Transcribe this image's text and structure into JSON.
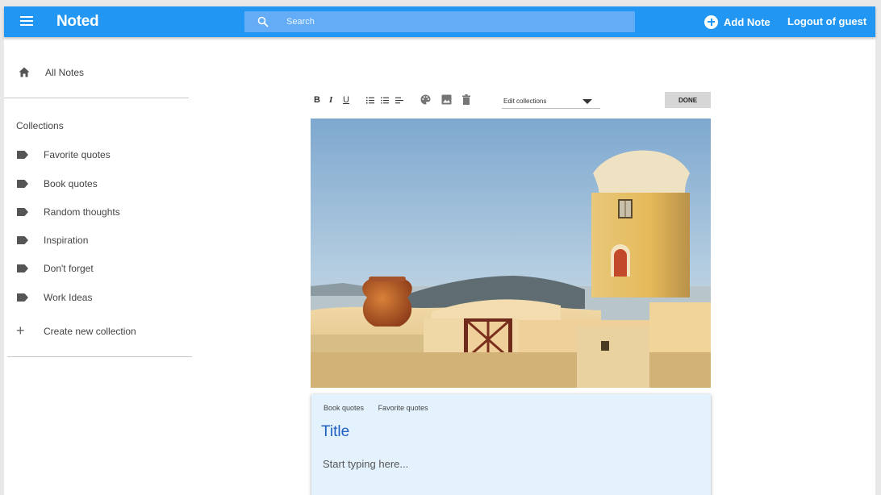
{
  "app": {
    "title": "Noted"
  },
  "header": {
    "search_placeholder": "Search",
    "add_note_label": "Add Note",
    "logout_label": "Logout of guest"
  },
  "sidebar": {
    "all_notes_label": "All Notes",
    "collections_heading": "Collections",
    "collections": [
      "Favorite quotes",
      "Book quotes",
      "Random thoughts",
      "Inspiration",
      "Don't forget",
      "Work Ideas"
    ],
    "create_collection_label": "Create new collection"
  },
  "editor": {
    "toolbar": {
      "bold": "B",
      "italic": "I",
      "underline": "U",
      "edit_collections_label": "Edit collections",
      "done_label": "DONE"
    },
    "note": {
      "tags": [
        "Book quotes",
        "Favorite quotes"
      ],
      "title": "Title",
      "body_placeholder": "Start typing here..."
    }
  },
  "colors": {
    "app_bar": "#2196f3",
    "search_bg": "#64adf6",
    "note_card_bg": "#e3f2fd",
    "note_title": "#1e5fbf"
  }
}
